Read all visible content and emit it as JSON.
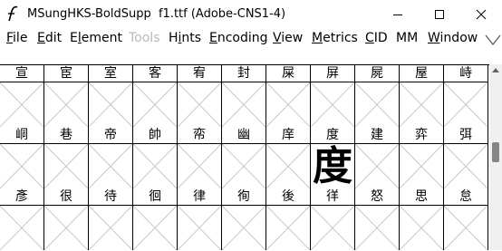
{
  "window": {
    "title": "MSungHKS-BoldSupp  f1.ttf (Adobe-CNS1-4)"
  },
  "menu": [
    {
      "label": "File",
      "mnemonic": "F",
      "rest": "ile",
      "enabled": true
    },
    {
      "label": "Edit",
      "mnemonic": "E",
      "rest": "dit",
      "enabled": true
    },
    {
      "label": "Element",
      "mnemonic": "l",
      "pre": "E",
      "rest": "ement",
      "enabled": true
    },
    {
      "label": "Tools",
      "enabled": false
    },
    {
      "label": "Hints",
      "mnemonic": "i",
      "pre": "H",
      "rest": "nts",
      "enabled": true
    },
    {
      "label": "Encoding",
      "mnemonic": "E",
      "rest": "ncoding",
      "enabled": true
    },
    {
      "label": "View",
      "mnemonic": "V",
      "rest": "iew",
      "enabled": true
    },
    {
      "label": "Metrics",
      "mnemonic": "M",
      "rest": "etrics",
      "enabled": true
    },
    {
      "label": "CID",
      "mnemonic": "C",
      "rest": "ID",
      "enabled": true
    },
    {
      "label": "MM",
      "enabled": true
    },
    {
      "label": "Window",
      "mnemonic": "W",
      "rest": "indow",
      "enabled": true
    }
  ],
  "grid": {
    "rows": [
      [
        "宣",
        "宦",
        "室",
        "客",
        "宥",
        "封",
        "屎",
        "屏",
        "屍",
        "屋",
        "峙"
      ],
      [
        "峒",
        "巷",
        "帝",
        "帥",
        "帟",
        "幽",
        "庠",
        "度",
        "建",
        "弈",
        "弭"
      ],
      [
        "彥",
        "很",
        "待",
        "徊",
        "律",
        "徇",
        "後",
        "徉",
        "怒",
        "思",
        "怠"
      ]
    ],
    "rendered": {
      "row": 1,
      "col": 7,
      "glyph": "度"
    }
  },
  "icons": {
    "app": "fontforge-icon",
    "minimize": "minimize-icon",
    "maximize": "maximize-icon",
    "close": "close-icon",
    "menu_overflow": "chevron-down-icon",
    "scroll_up": "scroll-up-icon"
  }
}
